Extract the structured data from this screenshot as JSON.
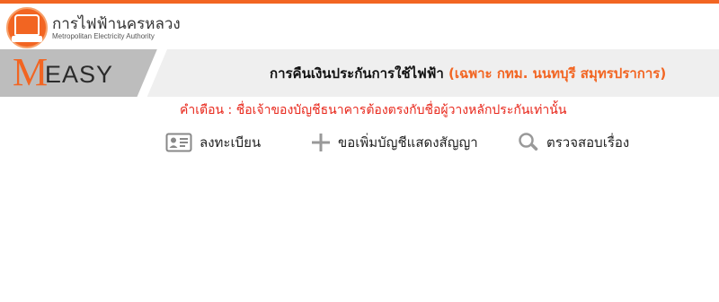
{
  "header": {
    "org_name_th": "การไฟฟ้านครหลวง",
    "org_name_en": "Metropolitan Electricity Authority",
    "logo_icon": "mea-seal-icon",
    "colors": {
      "accent": "#f26522",
      "warning": "#e8261a",
      "banner_bg": "#efefef"
    }
  },
  "banner": {
    "brand_letter": "M",
    "brand_text": "EASY",
    "title": "การคืนเงินประกันการใช้ไฟฟ้า",
    "area": "(เฉพาะ กทม. นนทบุรี สมุทรปราการ)"
  },
  "notice": {
    "text": "คำเตือน : ชื่อเจ้าของบัญชีธนาคารต้องตรงกับชื่อผู้วางหลักประกันเท่านั้น"
  },
  "nav": [
    {
      "label": "ลงทะเบียน",
      "icon": "id-card-icon"
    },
    {
      "label": "ขอเพิ่มบัญชีแสดงสัญญา",
      "icon": "plus-icon"
    },
    {
      "label": "ตรวจสอบเรื่อง",
      "icon": "search-icon"
    }
  ]
}
